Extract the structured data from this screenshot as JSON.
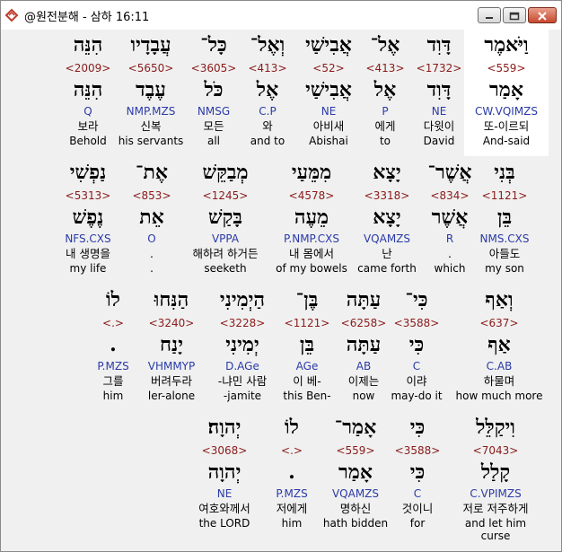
{
  "window": {
    "title": "@원전분해 - 삼하 16:11",
    "controls": [
      "minimize-icon",
      "maximize-icon",
      "close-icon"
    ]
  },
  "rows": [
    {
      "words": [
        {
          "heb": "וַיֹּאמֶר",
          "strong": "<559>",
          "lemma": "אָמַר",
          "morph": "CW.VQIMZS",
          "kor": "또-이르되",
          "eng": "And-said"
        },
        {
          "heb": "דָּוִד",
          "strong": "<1732>",
          "lemma": "דָּוִד",
          "morph": "NE",
          "kor": "다윗이",
          "eng": "David"
        },
        {
          "heb": "אֶל־",
          "strong": "<413>",
          "lemma": "אֶל",
          "morph": "P",
          "kor": "에게",
          "eng": "to"
        },
        {
          "heb": "אֲבִישַׁי",
          "strong": "<52>",
          "lemma": "אֲבִישַׁי",
          "morph": "NE",
          "kor": "아비새",
          "eng": "Abishai"
        },
        {
          "heb": "וְאֶל־",
          "strong": "<413>",
          "lemma": "אֶל",
          "morph": "C.P",
          "kor": "와",
          "eng": "and to"
        },
        {
          "heb": "כָּל־",
          "strong": "<3605>",
          "lemma": "כֹּל",
          "morph": "NMSG",
          "kor": "모든",
          "eng": "all"
        },
        {
          "heb": "עֲבָדָיו",
          "strong": "<5650>",
          "lemma": "עֶבֶד",
          "morph": "NMP.MZS",
          "kor": "신복",
          "eng": "his servants"
        },
        {
          "heb": "הִנֵּה",
          "strong": "<2009>",
          "lemma": "הִנֵּה",
          "morph": "Q",
          "kor": "보라",
          "eng": "Behold"
        }
      ]
    },
    {
      "words": [
        {
          "heb": "בְּנִי",
          "strong": "<1121>",
          "lemma": "בֵּן",
          "morph": "NMS.CXS",
          "kor": "아들도",
          "eng": "my son"
        },
        {
          "heb": "אֲשֶׁר־",
          "strong": "<834>",
          "lemma": "אֲשֶׁר",
          "morph": "R",
          "kor": ".",
          "eng": "which"
        },
        {
          "heb": "יָצָא",
          "strong": "<3318>",
          "lemma": "יָצָא",
          "morph": "VQAMZS",
          "kor": "난",
          "eng": "came forth"
        },
        {
          "heb": "מִמֵּעַי",
          "strong": "<4578>",
          "lemma": "מֵעֶה",
          "morph": "P.NMP.CXS",
          "kor": "내 몸에서",
          "eng": "of my bowels"
        },
        {
          "heb": "מְבַקֵּשׁ",
          "strong": "<1245>",
          "lemma": "בָּקַשׁ",
          "morph": "VPPA",
          "kor": "해하려 하거든",
          "eng": "seeketh"
        },
        {
          "heb": "אֶת־",
          "strong": "<853>",
          "lemma": "אֵת",
          "morph": "O",
          "kor": ".",
          "eng": "."
        },
        {
          "heb": "נַפְשִׁי",
          "strong": "<5313>",
          "lemma": "נֶפֶשׁ",
          "morph": "NFS.CXS",
          "kor": "내 생명을",
          "eng": "my life"
        }
      ]
    },
    {
      "words": [
        {
          "heb": "וְאַף",
          "strong": "<637>",
          "lemma": "אַף",
          "morph": "C.AB",
          "kor": "하물며",
          "eng": "how much more"
        },
        {
          "heb": "כִּי־",
          "strong": "<3588>",
          "lemma": "כִּי",
          "morph": "C",
          "kor": "이랴",
          "eng": "may-do it"
        },
        {
          "heb": "עַתָּה",
          "strong": "<6258>",
          "lemma": "עַתָּה",
          "morph": "AB",
          "kor": "이제는",
          "eng": "now"
        },
        {
          "heb": "בֶּן־",
          "strong": "<1121>",
          "lemma": "בֵּן",
          "morph": "AGe",
          "kor": "이 베-",
          "eng": "this Ben-"
        },
        {
          "heb": "הַיְמִינִי",
          "strong": "<3228>",
          "lemma": "יְמִינִי",
          "morph": "D.AGe",
          "kor": "-냐민 사람",
          "eng": "-jamite"
        },
        {
          "heb": "הַנִּחוּ",
          "strong": "<3240>",
          "lemma": "יָנַח",
          "morph": "VHMMYP",
          "kor": "버려두라",
          "eng": "ler-alone"
        },
        {
          "heb": "לוֹ",
          "strong": "<.>",
          "lemma": ".",
          "morph": "P.MZS",
          "kor": "그를",
          "eng": "him"
        }
      ]
    },
    {
      "words": [
        {
          "heb": "וִיקַלֵּל",
          "strong": "<7043>",
          "lemma": "קָלַל",
          "morph": "C.VPIMZS",
          "kor": "저로 저주하게",
          "eng": "and let him curse"
        },
        {
          "heb": "כִּי",
          "strong": "<3588>",
          "lemma": "כִּי",
          "morph": "C",
          "kor": "것이니",
          "eng": "for"
        },
        {
          "heb": "אָמַר־",
          "strong": "<559>",
          "lemma": "אָמַר",
          "morph": "VQAMZS",
          "kor": "명하신",
          "eng": "hath bidden"
        },
        {
          "heb": "לוֹ",
          "strong": "<.>",
          "lemma": ".",
          "morph": "P.MZS",
          "kor": "저에게",
          "eng": "him"
        },
        {
          "heb": "יְהוָה׃",
          "strong": "<3068>",
          "lemma": "יְהוָה",
          "morph": "NE",
          "kor": "여호와께서",
          "eng": "the LORD"
        }
      ]
    }
  ],
  "colors": {
    "strong": "#8b1a1a",
    "morph": "#2a3aa8",
    "highlight": "#ffffff",
    "background": "#f0f0f0"
  }
}
